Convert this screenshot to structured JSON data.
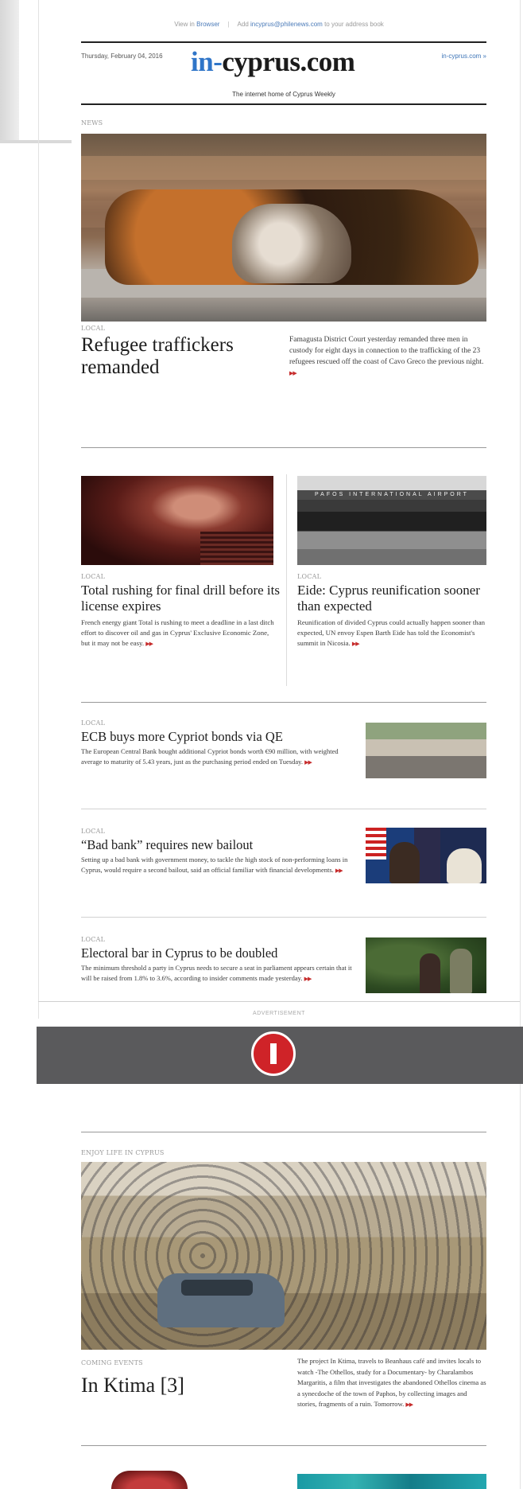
{
  "header": {
    "view_prefix": "View in",
    "view_link": "Browser",
    "add_prefix": "Add",
    "add_email": "incyprus@philenews.com",
    "add_suffix": "to your address book",
    "date": "Thursday, February 04, 2016",
    "logo_in": "in-",
    "logo_rest": "cyprus.com",
    "site_link": "in-cyprus.com »",
    "tagline": "The internet home of Cyprus Weekly"
  },
  "sections": {
    "news": "NEWS",
    "advertisement": "ADVERTISEMENT",
    "enjoy": "ENJOY LIFE IN CYPRUS"
  },
  "lead": {
    "kicker": "LOCAL",
    "title": "Refugee traffickers remanded",
    "summary": "Famagusta District Court yesterday remanded three men in custody for eight days in connection to the trafficking of the 23 refugees rescued off the coast of Cavo Greco the previous night.",
    "more": "▶▶"
  },
  "col_left": {
    "kicker": "LOCAL",
    "title": "Total rushing for final drill before its license expires",
    "summary": "French energy giant Total is rushing to meet a deadline in a last ditch effort to discover oil and gas in Cyprus' Exclusive Economic Zone, but it may not be easy.",
    "more": "▶▶"
  },
  "col_right": {
    "kicker": "LOCAL",
    "image_sign": "PAFOS INTERNATIONAL AIRPORT",
    "title": "Eide: Cyprus reunification sooner than expected",
    "summary": "Reunification of divided Cyprus could actually happen sooner than expected, UN envoy Espen Barth Eide has told the Economist's summit in Nicosia.",
    "more": "▶▶"
  },
  "rows": [
    {
      "kicker": "LOCAL",
      "title": "ECB buys more Cypriot bonds via QE",
      "summary": "The European Central Bank bought additional Cypriot bonds worth €90 million, with weighted average to maturity of 5.43 years, just as the purchasing period ended on Tuesday.",
      "more": "▶▶"
    },
    {
      "kicker": "LOCAL",
      "title": "“Bad bank” requires new bailout",
      "summary": "Setting up a bad bank with government money, to tackle the high stock of non-performing loans in Cyprus, would require a second bailout, said an official familiar with financial developments.",
      "more": "▶▶"
    },
    {
      "kicker": "LOCAL",
      "title": "Electoral bar in Cyprus to be doubled",
      "summary": "The minimum threshold a party in Cyprus needs to secure a seat in parliament appears certain that it will be raised from 1.8% to 3.6%, according to insider comments made yesterday.",
      "more": "▶▶"
    }
  ],
  "event": {
    "kicker": "COMING EVENTS",
    "title": "In Ktima [3]",
    "summary": "The project In Ktima, travels to Beanhaus café and invites locals to watch -The Othellos, study for a Documentary- by Charalambos Margaritis, a film that investigates the abandoned Othellos cinema as a synecdoche of the town of Paphos, by collecting images and stories, fragments of a ruin. Tomorrow.",
    "more": "▶▶"
  },
  "colors": {
    "accent_blue": "#2f75c8",
    "arrow_red": "#c62c2c",
    "ad_gray": "#5a5a5c",
    "ad_red": "#cf2328"
  }
}
